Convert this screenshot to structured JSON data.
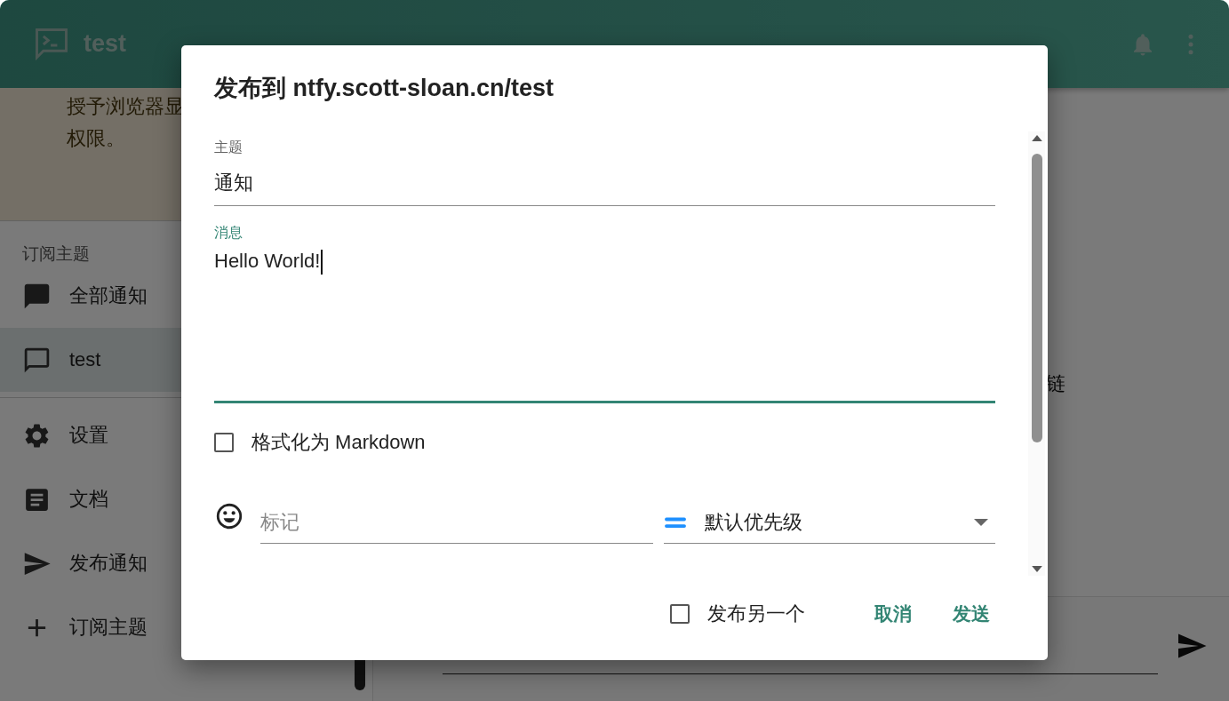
{
  "app_bar": {
    "title": "test"
  },
  "banner": {
    "lines": [
      "授予浏览器显",
      "权限。"
    ]
  },
  "sidebar": {
    "section_label": "订阅主题",
    "topics": [
      {
        "label": "全部通知",
        "kind": "all",
        "selected": false
      },
      {
        "label": "test",
        "kind": "topic",
        "selected": true
      }
    ],
    "actions": [
      {
        "label": "设置",
        "kind": "settings"
      },
      {
        "label": "文档",
        "kind": "docs"
      },
      {
        "label": "发布通知",
        "kind": "publish"
      },
      {
        "label": "订阅主题",
        "kind": "subscribe"
      }
    ]
  },
  "main": {
    "partial_text": "链"
  },
  "dialog": {
    "title": "发布到 ntfy.scott-sloan.cn/test",
    "fields": [
      {
        "label": "主题",
        "value": "通知",
        "focused": false,
        "multiline": false
      },
      {
        "label": "消息",
        "value": "Hello World!",
        "focused": true,
        "multiline": true
      }
    ],
    "markdown_checkbox": {
      "label": "格式化为 Markdown",
      "checked": false
    },
    "tags": {
      "placeholder": "标记"
    },
    "priority": {
      "value": "默认优先级"
    },
    "publish_another": {
      "label": "发布另一个",
      "checked": false
    },
    "buttons": [
      "取消",
      "发送"
    ]
  }
}
